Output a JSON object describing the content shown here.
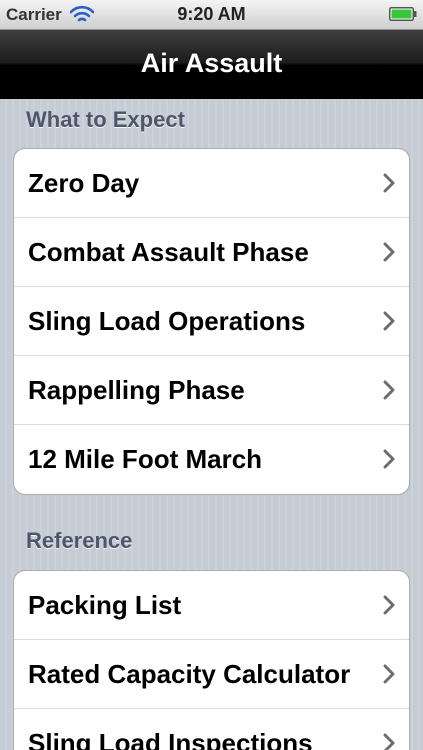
{
  "status_bar": {
    "carrier": "Carrier",
    "time": "9:20 AM",
    "wifi_icon": "wifi-icon",
    "battery_icon": "battery-icon"
  },
  "nav": {
    "title": "Air Assault"
  },
  "sections": [
    {
      "header": "What to Expect",
      "items": [
        {
          "label": "Zero Day"
        },
        {
          "label": "Combat Assault Phase"
        },
        {
          "label": "Sling Load Operations"
        },
        {
          "label": "Rappelling Phase"
        },
        {
          "label": "12 Mile Foot March"
        }
      ]
    },
    {
      "header": "Reference",
      "items": [
        {
          "label": "Packing List"
        },
        {
          "label": "Rated Capacity Calculator"
        },
        {
          "label": "Sling Load Inspections"
        }
      ]
    }
  ],
  "colors": {
    "background": "#c5ccd4",
    "section_header": "#4c566c",
    "nav_bar": "#000000",
    "battery_fill": "#35c93a",
    "chevron": "#6d6d6d"
  }
}
